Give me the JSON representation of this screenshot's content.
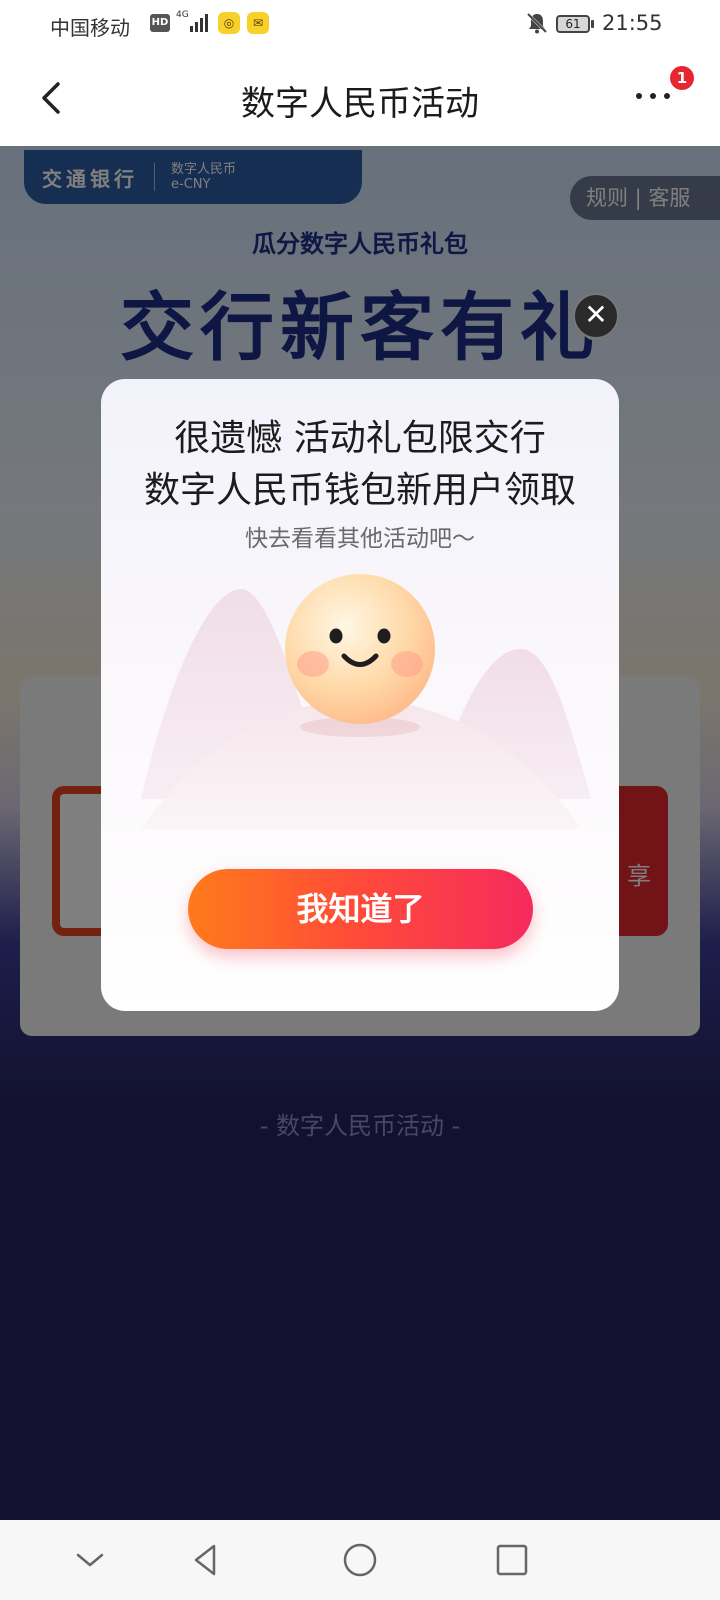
{
  "status_bar": {
    "carrier": "中国移动",
    "hd": "HD",
    "network": "4G",
    "battery": "61",
    "time": "21:55"
  },
  "header": {
    "title": "数字人民币活动",
    "notification_count": "1"
  },
  "background": {
    "bank_name": "交通银行",
    "ecny_label": "数字人民币",
    "ecny_sub": "e-CNY",
    "rules_label": "规则 | 客服",
    "subtitle": "瓜分数字人民币礼包",
    "hero_title": "交行新客有礼",
    "card_right_text": "享",
    "footer_text": "- 数字人民币活动 -"
  },
  "modal": {
    "line1": "很遗憾 活动礼包限交行",
    "line2": "数字人民币钱包新用户领取",
    "hint": "快去看看其他活动吧～",
    "confirm_label": "我知道了",
    "close_label": "✕"
  },
  "colors": {
    "accent_start": "#ff7a1a",
    "accent_end": "#f52a5e",
    "brand_blue": "#1c2e86",
    "page_dark": "#25235e"
  }
}
